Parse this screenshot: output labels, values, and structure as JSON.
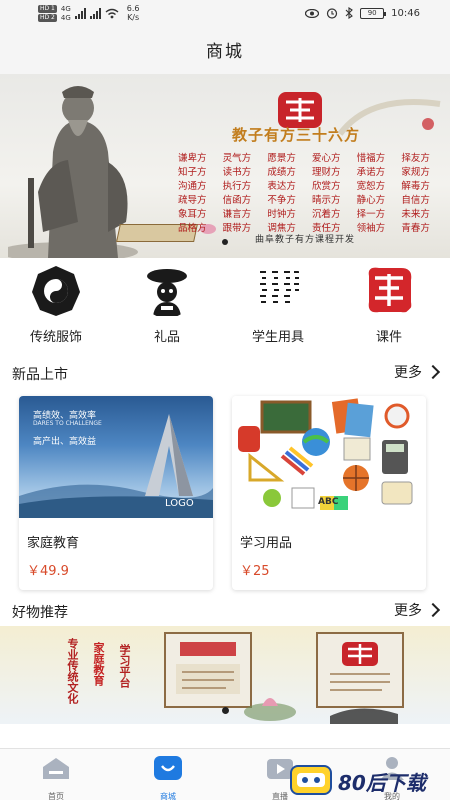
{
  "status_bar": {
    "sim1": "HD 1",
    "sim2": "HD 2",
    "net1": "4G",
    "net2": "4G",
    "speed_value": "6.6",
    "speed_unit": "K/s",
    "battery": "90",
    "time": "10:46"
  },
  "header": {
    "title": "商城"
  },
  "banner": {
    "tagline": "教子有方三十六方",
    "poem": [
      "谦卑方",
      "灵气方",
      "愿景方",
      "爱心方",
      "惜福方",
      "择友方",
      "知子方",
      "读书方",
      "成绩方",
      "理财方",
      "承诺方",
      "家规方",
      "沟通方",
      "执行方",
      "表达方",
      "欣赏方",
      "宽恕方",
      "解毒方",
      "疏导方",
      "信函方",
      "不争方",
      "晴示方",
      "静心方",
      "自信方",
      "象耳方",
      "谦言方",
      "时钟方",
      "沉着方",
      "择一方",
      "未来方",
      "品格方",
      "跟带方",
      "调焦方",
      "责任方",
      "领袖方",
      "青春方"
    ],
    "footer": "曲阜教子有方课程开发",
    "active_slide": 1
  },
  "categories": [
    {
      "label": "传统服饰",
      "icon": "bagua-icon"
    },
    {
      "label": "礼品",
      "icon": "gift-icon"
    },
    {
      "label": "学生用具",
      "icon": "calligraphy-icon"
    },
    {
      "label": "课件",
      "icon": "seal-logo-icon"
    }
  ],
  "new_products": {
    "title": "新品上市",
    "more": "更多",
    "items": [
      {
        "name": "家庭教育",
        "price": "￥49.9",
        "image_lines": [
          "高绩效、高效率",
          "DARES TO CHALLENGE",
          "高产出、高效益",
          "LOGO"
        ]
      },
      {
        "name": "学习用品",
        "price": "￥25",
        "image_lines": [
          "ABC"
        ]
      }
    ]
  },
  "recommend": {
    "title": "好物推荐",
    "more": "更多",
    "promo_text": [
      "专业传统文化",
      "家庭教育",
      "学习平台"
    ]
  },
  "tabbar": {
    "items": [
      {
        "label": "首页",
        "icon": "home-icon",
        "active": false
      },
      {
        "label": "商城",
        "icon": "mall-icon",
        "active": true
      },
      {
        "label": "直播",
        "icon": "live-icon",
        "active": false
      },
      {
        "label": "我的",
        "icon": "user-icon",
        "active": false
      }
    ]
  },
  "watermark": {
    "text": "80后下载"
  },
  "colors": {
    "accent": "#1f7ae0",
    "price": "#d84a2a",
    "brand_red": "#b01c1c"
  }
}
